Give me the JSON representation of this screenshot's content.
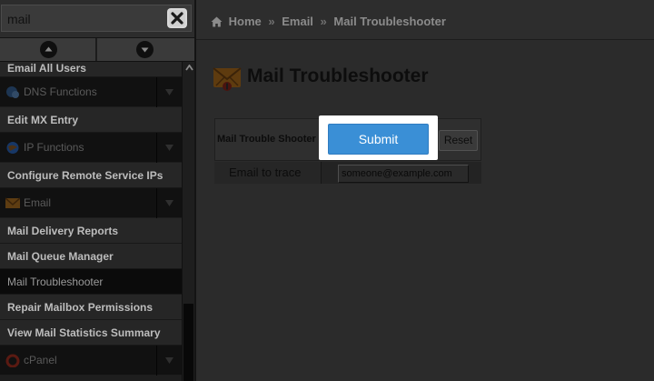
{
  "search": {
    "value": "mail"
  },
  "sidebar": {
    "items": [
      {
        "type": "item",
        "label": "Email All Users",
        "name": "sidebar-item-email-all-users"
      },
      {
        "type": "group",
        "label": "DNS Functions",
        "icon": "dns-globe-icon",
        "name": "sidebar-group-dns-functions"
      },
      {
        "type": "item",
        "label": "Edit MX Entry",
        "name": "sidebar-item-edit-mx-entry"
      },
      {
        "type": "group",
        "label": "IP Functions",
        "icon": "ip-globe-icon",
        "name": "sidebar-group-ip-functions"
      },
      {
        "type": "item",
        "label": "Configure Remote Service IPs",
        "name": "sidebar-item-configure-remote-service-ips"
      },
      {
        "type": "group",
        "label": "Email",
        "icon": "envelope-icon",
        "name": "sidebar-group-email"
      },
      {
        "type": "item",
        "label": "Mail Delivery Reports",
        "name": "sidebar-item-mail-delivery-reports"
      },
      {
        "type": "item",
        "label": "Mail Queue Manager",
        "name": "sidebar-item-mail-queue-manager"
      },
      {
        "type": "item",
        "label": "Mail Troubleshooter",
        "name": "sidebar-item-mail-troubleshooter",
        "active": true
      },
      {
        "type": "item",
        "label": "Repair Mailbox Permissions",
        "name": "sidebar-item-repair-mailbox-permissions"
      },
      {
        "type": "item",
        "label": "View Mail Statistics Summary",
        "name": "sidebar-item-view-mail-statistics-summary"
      },
      {
        "type": "group",
        "label": "cPanel",
        "icon": "cpanel-logo-icon",
        "name": "sidebar-group-cpanel"
      }
    ]
  },
  "breadcrumb": {
    "home": "Home",
    "sep": "»",
    "section": "Email",
    "current": "Mail Troubleshooter"
  },
  "page": {
    "title": "Mail Troubleshooter"
  },
  "form": {
    "header_label": "Mail Trouble Shooter",
    "submit_label": "Submit",
    "reset_label": "Reset",
    "email_label": "Email to trace",
    "email_value": "someone@example.com"
  },
  "colors": {
    "submit_blue": "#3a8fd6",
    "spotlight_white": "#ffffff",
    "overlay_dark": "#2b2b2b"
  }
}
